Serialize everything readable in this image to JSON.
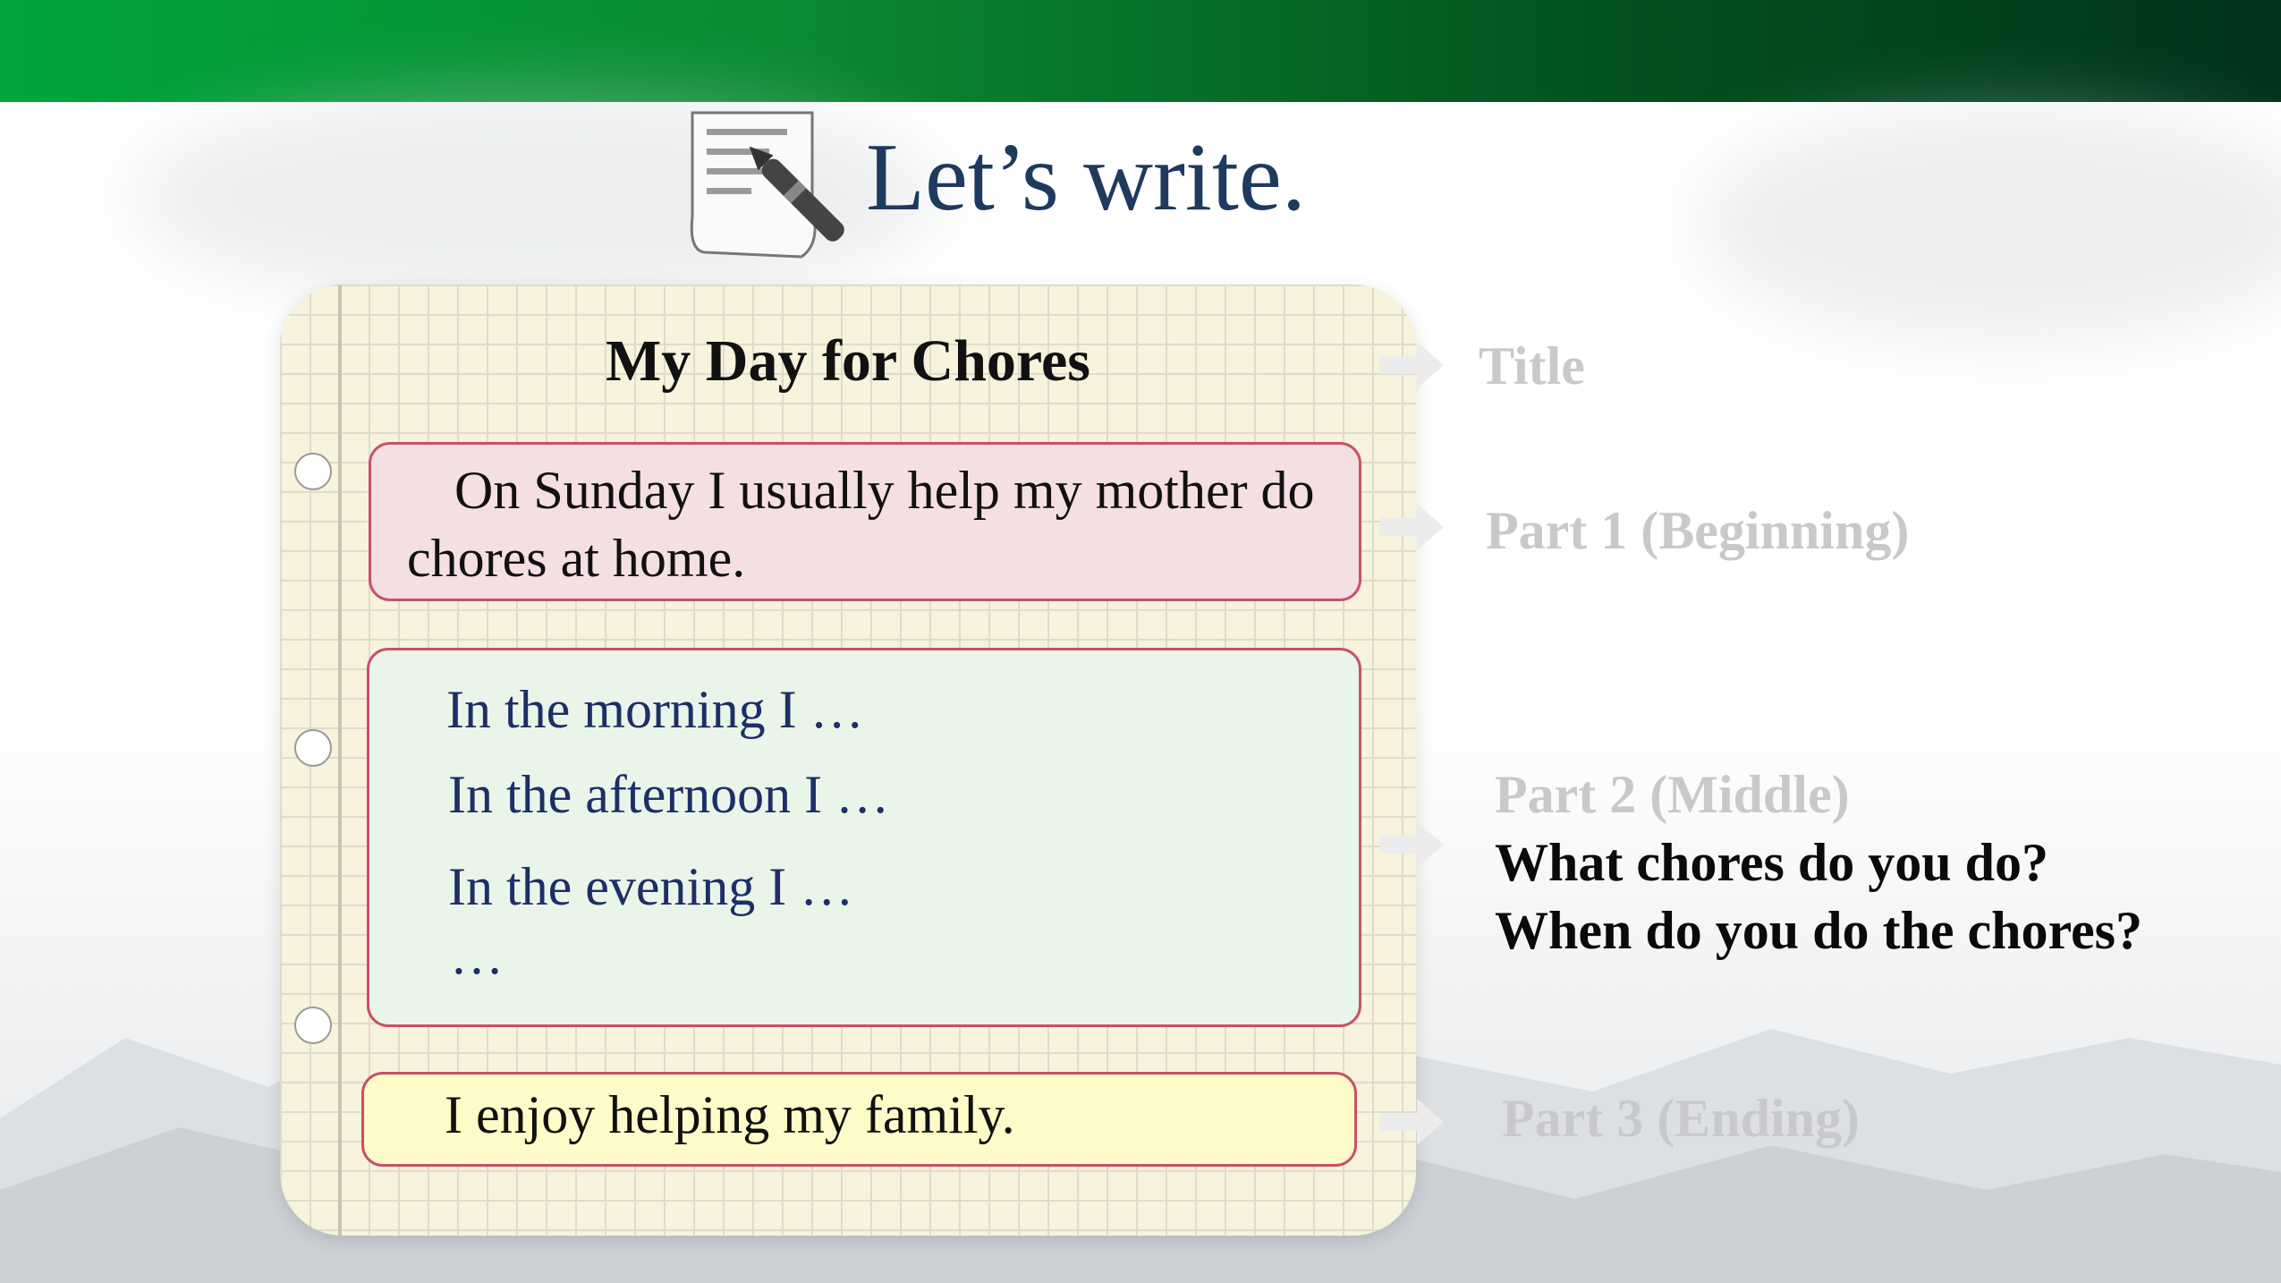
{
  "slide": {
    "title": "Let’s write."
  },
  "notebook": {
    "title": "My Day for Chores",
    "beginning": {
      "line1": "On Sunday I usually help my mother do",
      "line2": "chores at home."
    },
    "middle": {
      "line1": "In the morning I …",
      "line2": "In the afternoon I …",
      "line3": "In the evening I …",
      "line4": "…"
    },
    "ending": {
      "line1": "I enjoy helping my family."
    }
  },
  "labels": {
    "title": "Title",
    "part1": "Part 1 (Beginning)",
    "part2": "Part 2 (Middle)",
    "part2_q1": "What chores do you do?",
    "part2_q2": "When do you do the chores?",
    "part3": "Part 3 (Ending)"
  },
  "colors": {
    "brand_green": "#00a63a",
    "title_navy": "#1f3a5f",
    "box_border": "#c8506a",
    "label_grey": "#c9c9cc"
  },
  "icons": {
    "document": "document-pen-icon",
    "arrow": "arrow-right-icon"
  }
}
